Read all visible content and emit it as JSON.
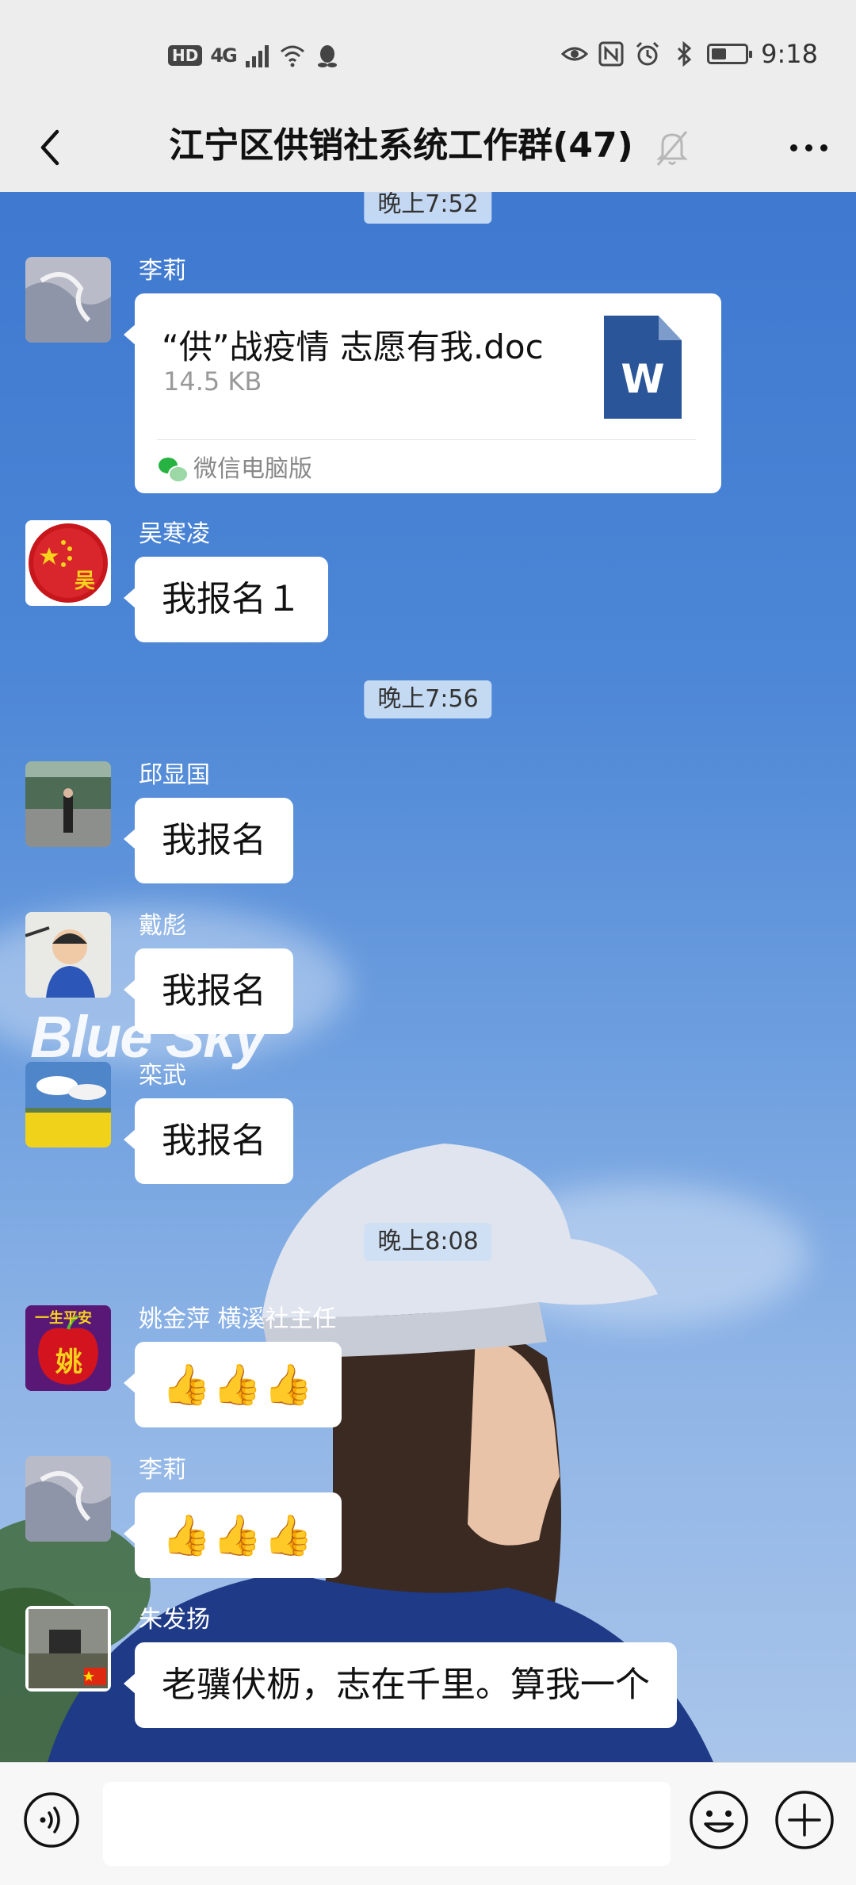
{
  "status_bar": {
    "hd": "HD",
    "network": "4G",
    "time": "9:18",
    "battery_level": 0.45
  },
  "header": {
    "title": "江宁区供销社系统工作群(47)"
  },
  "chat": {
    "background_text": "Blue Sky",
    "timestamps": [
      "晚上7:52",
      "晚上7:56",
      "晚上8:08"
    ],
    "messages": [
      {
        "sender": "李莉",
        "file": {
          "name": "“供”战疫情 志愿有我.doc",
          "size": "14.5 KB",
          "icon_letter": "W",
          "source": "微信电脑版"
        }
      },
      {
        "sender": "吴寒凌",
        "text": "我报名１",
        "avatar_text": "吴"
      },
      {
        "sender": "邱显国",
        "text": "我报名"
      },
      {
        "sender": "戴彪",
        "text": "我报名"
      },
      {
        "sender": "栾武",
        "text": "我报名"
      },
      {
        "sender": "姚金萍 横溪社主任",
        "text": "👍👍👍",
        "avatar_text": "一生平安",
        "avatar_char": "姚"
      },
      {
        "sender": "李莉",
        "text": "👍👍👍"
      },
      {
        "sender": "朱发扬",
        "text": "老骥伏枥，志在千里。算我一个"
      }
    ]
  },
  "colors": {
    "accent_green": "#27b341",
    "word_blue": "#2a5699",
    "bar_gray": "#ededed"
  }
}
